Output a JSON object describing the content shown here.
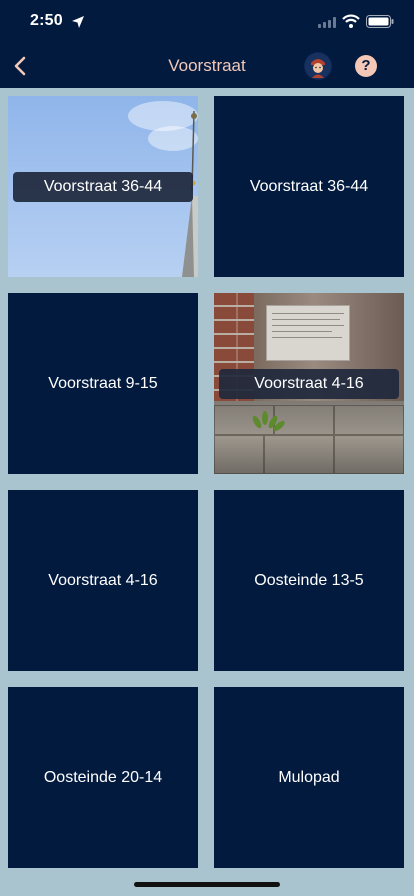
{
  "status_bar": {
    "time": "2:50",
    "icons": [
      "location-arrow-icon",
      "signal-icon",
      "wifi-icon",
      "battery-icon"
    ]
  },
  "navbar": {
    "title": "Voorstraat",
    "back_icon": "chevron-left-icon",
    "avatar_icon": "avatar-icon",
    "help_label": "?"
  },
  "colors": {
    "header_bg": "#031a3f",
    "title": "#f2c9b8",
    "tile_bg": "#031a3f",
    "page_bg": "#a9c3cf",
    "help_badge": "#f4c7b7"
  },
  "tiles": [
    {
      "label": "Voorstraat 36-44",
      "photo": "sky-tower"
    },
    {
      "label": "Voorstraat 36-44",
      "photo": ""
    },
    {
      "label": "Voorstraat 9-15",
      "photo": ""
    },
    {
      "label": "Voorstraat 4-16",
      "photo": "plaque-wall"
    },
    {
      "label": "Voorstraat 4-16",
      "photo": ""
    },
    {
      "label": "Oosteinde 13-5",
      "photo": ""
    },
    {
      "label": "Oosteinde 20-14",
      "photo": ""
    },
    {
      "label": "Mulopad",
      "photo": ""
    }
  ]
}
